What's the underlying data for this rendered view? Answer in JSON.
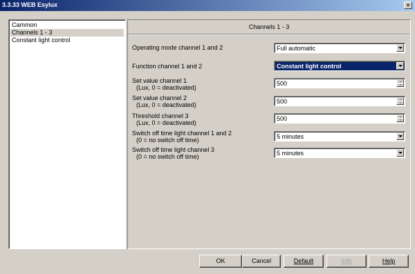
{
  "window": {
    "title": "3.3.33 WEB Esylux"
  },
  "tree": {
    "items": [
      {
        "label": "Cammon"
      },
      {
        "label": "Channels 1 - 3"
      },
      {
        "label": "Constant light control"
      }
    ]
  },
  "panel": {
    "header": "Channels 1 - 3",
    "params": [
      {
        "label": "Operating mode channel 1 and 2",
        "sub": "",
        "value": "Full automatic",
        "control": "dropdown"
      },
      {
        "label": "Function channel 1 and 2",
        "sub": "",
        "value": "Constant light control",
        "control": "dropdown",
        "highlight": true
      },
      {
        "label": "Set value channel 1",
        "sub": "(Lux, 0 = deactivated)",
        "value": "500",
        "control": "spinner"
      },
      {
        "label": "Set value channel 2",
        "sub": "(Lux, 0 = deactivated)",
        "value": "500",
        "control": "spinner"
      },
      {
        "label": "Threshold channel 3",
        "sub": "(Lux, 0 = deactivated)",
        "value": "500",
        "control": "spinner"
      },
      {
        "label": "Switch off time light channel 1 and 2",
        "sub": "(0 = no switch off time)",
        "value": "5 minutes",
        "control": "dropdown"
      },
      {
        "label": "Switch off time light channel 3",
        "sub": "(0 = no switch off time)",
        "value": "5 minutes",
        "control": "dropdown"
      }
    ]
  },
  "buttons": {
    "ok": "OK",
    "cancel": "Cancel",
    "default": "Default",
    "info": "Info",
    "help": "Help"
  },
  "colors": {
    "highlight": "#0a246a",
    "face": "#d4d0c8"
  }
}
